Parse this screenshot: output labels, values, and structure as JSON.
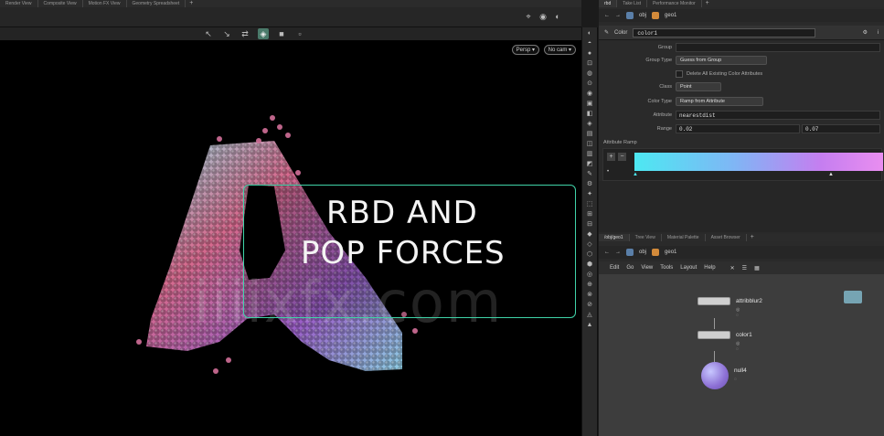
{
  "viewport_tabs": [
    "Render View",
    "Composite View",
    "Motion FX View",
    "Geometry Spreadsheet"
  ],
  "viewport": {
    "toolbar_icons": [
      "select-icon",
      "transform-icon",
      "handle-icon",
      "view-icon",
      "display-icon"
    ],
    "dropdown_left": "Persp ▾",
    "dropdown_right": "No cam ▾"
  },
  "overlay": {
    "line1": "RBD AND",
    "line2": "POP FORCES",
    "watermark": "iiiixfx.com"
  },
  "params_tabs": [
    "rbd",
    "Take List",
    "Performance Monitor"
  ],
  "params_path": {
    "obj": "obj",
    "geo": "geo1"
  },
  "params": {
    "node_type": "Color",
    "node_name": "color1",
    "group_label": "Group",
    "group_value": "",
    "group_type_label": "Group Type",
    "group_type_value": "Guess from Group",
    "delete_label": "Delete All Existing Color Attributes",
    "class_label": "Class",
    "class_value": "Point",
    "color_type_label": "Color Type",
    "color_type_value": "Ramp from Attribute",
    "attribute_label": "Attribute",
    "attribute_value": "nearestdist",
    "range_label": "Range",
    "range_min": "0.02",
    "range_max": "0.07",
    "ramp_label": "Attribute Ramp",
    "ramp_start": "#4de8f2",
    "ramp_end": "#e98ef0"
  },
  "network_tabs": [
    "/obj/geo1",
    "Tree View",
    "Material Palette",
    "Asset Browser"
  ],
  "network_path": {
    "obj": "obj",
    "geo": "geo1"
  },
  "network_menu": [
    "Edit",
    "Go",
    "View",
    "Tools",
    "Layout",
    "Help"
  ],
  "nodes": [
    {
      "name": "attribblur2"
    },
    {
      "name": "color1"
    },
    {
      "name": "null4"
    }
  ]
}
